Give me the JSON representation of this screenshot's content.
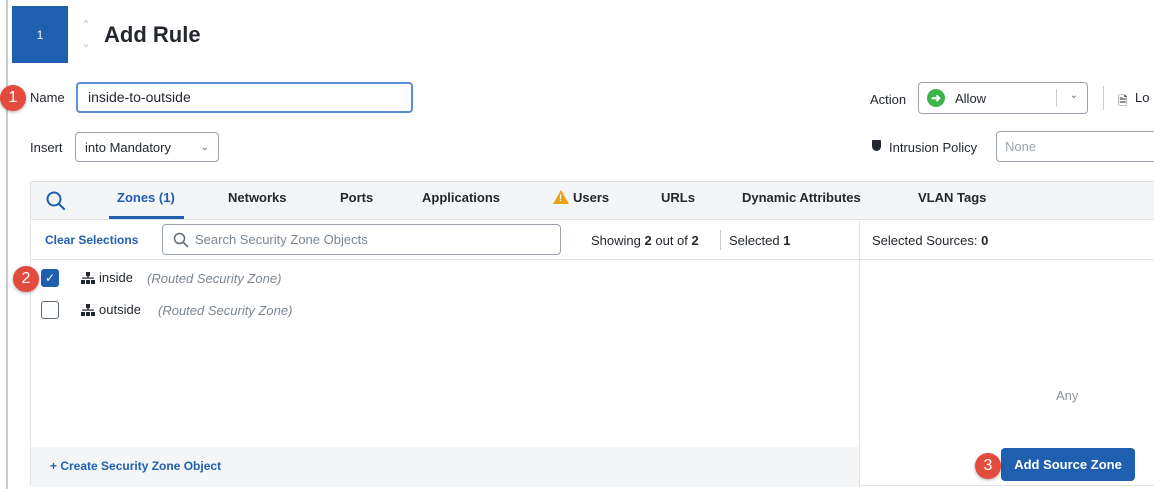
{
  "header": {
    "step_number": "1",
    "title": "Add Rule"
  },
  "form": {
    "name_label": "Name",
    "name_value": "inside-to-outside",
    "insert_label": "Insert",
    "insert_value": "into Mandatory",
    "action_label": "Action",
    "action_value": "Allow",
    "log_label": "Lo",
    "intrusion_label": "Intrusion Policy",
    "intrusion_placeholder": "None"
  },
  "tabs": [
    {
      "label": "Zones (1)",
      "active": true
    },
    {
      "label": "Networks"
    },
    {
      "label": "Ports"
    },
    {
      "label": "Applications"
    },
    {
      "label": "Users",
      "warning": true
    },
    {
      "label": "URLs"
    },
    {
      "label": "Dynamic Attributes"
    },
    {
      "label": "VLAN Tags"
    }
  ],
  "toolbar": {
    "clear_selections": "Clear Selections",
    "search_placeholder": "Search Security Zone Objects",
    "showing_prefix": "Showing",
    "showing_count": "2",
    "showing_mid": "out of",
    "showing_total": "2",
    "selected_prefix": "Selected",
    "selected_count": "1"
  },
  "zones": [
    {
      "name": "inside",
      "type": "(Routed Security Zone)",
      "checked": true
    },
    {
      "name": "outside",
      "type": "(Routed Security Zone)",
      "checked": false
    }
  ],
  "footer": {
    "create_link": "+ Create Security Zone Object"
  },
  "right_pane": {
    "selected_sources_label": "Selected Sources:",
    "selected_sources_count": "0",
    "empty_text": "Any",
    "add_button": "Add Source Zone"
  },
  "badges": [
    "1",
    "2",
    "3"
  ],
  "colors": {
    "accent": "#1f5fb0",
    "badge": "#e34b3e",
    "allow": "#3cb54a",
    "warning": "#e8a317"
  }
}
